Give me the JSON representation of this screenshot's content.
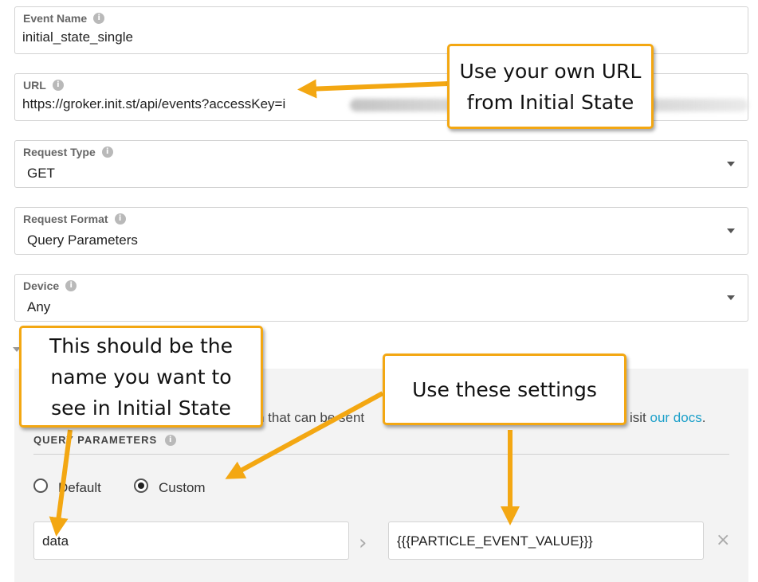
{
  "fields": {
    "event_name": {
      "label": "Event Name",
      "value": "initial_state_single"
    },
    "url": {
      "label": "URL",
      "value": "https://groker.init.st/api/events?accessKey=i"
    },
    "request_type": {
      "label": "Request Type",
      "value": "GET"
    },
    "request_format": {
      "label": "Request Format",
      "value": "Query Parameters"
    },
    "device": {
      "label": "Device",
      "value": "Any"
    }
  },
  "advanced": {
    "text_fragment": "n that can be sent",
    "visit_text": "isit",
    "docs_link": "our docs",
    "period": ".",
    "section_title": "QUERY PARAMETERS",
    "radio_default_label": "Default",
    "radio_custom_label": "Custom",
    "selected_option": "Custom",
    "param_key": "data",
    "param_value": "{{{PARTICLE_EVENT_VALUE}}}"
  },
  "annotations": {
    "url_callout": "Use your own URL from Initial State",
    "name_callout": "This should be the name you want to see in Initial State",
    "settings_callout": "Use these settings"
  },
  "colors": {
    "callout_border": "#f3a712",
    "arrow": "#f3a712",
    "link": "#1a9fc9"
  }
}
